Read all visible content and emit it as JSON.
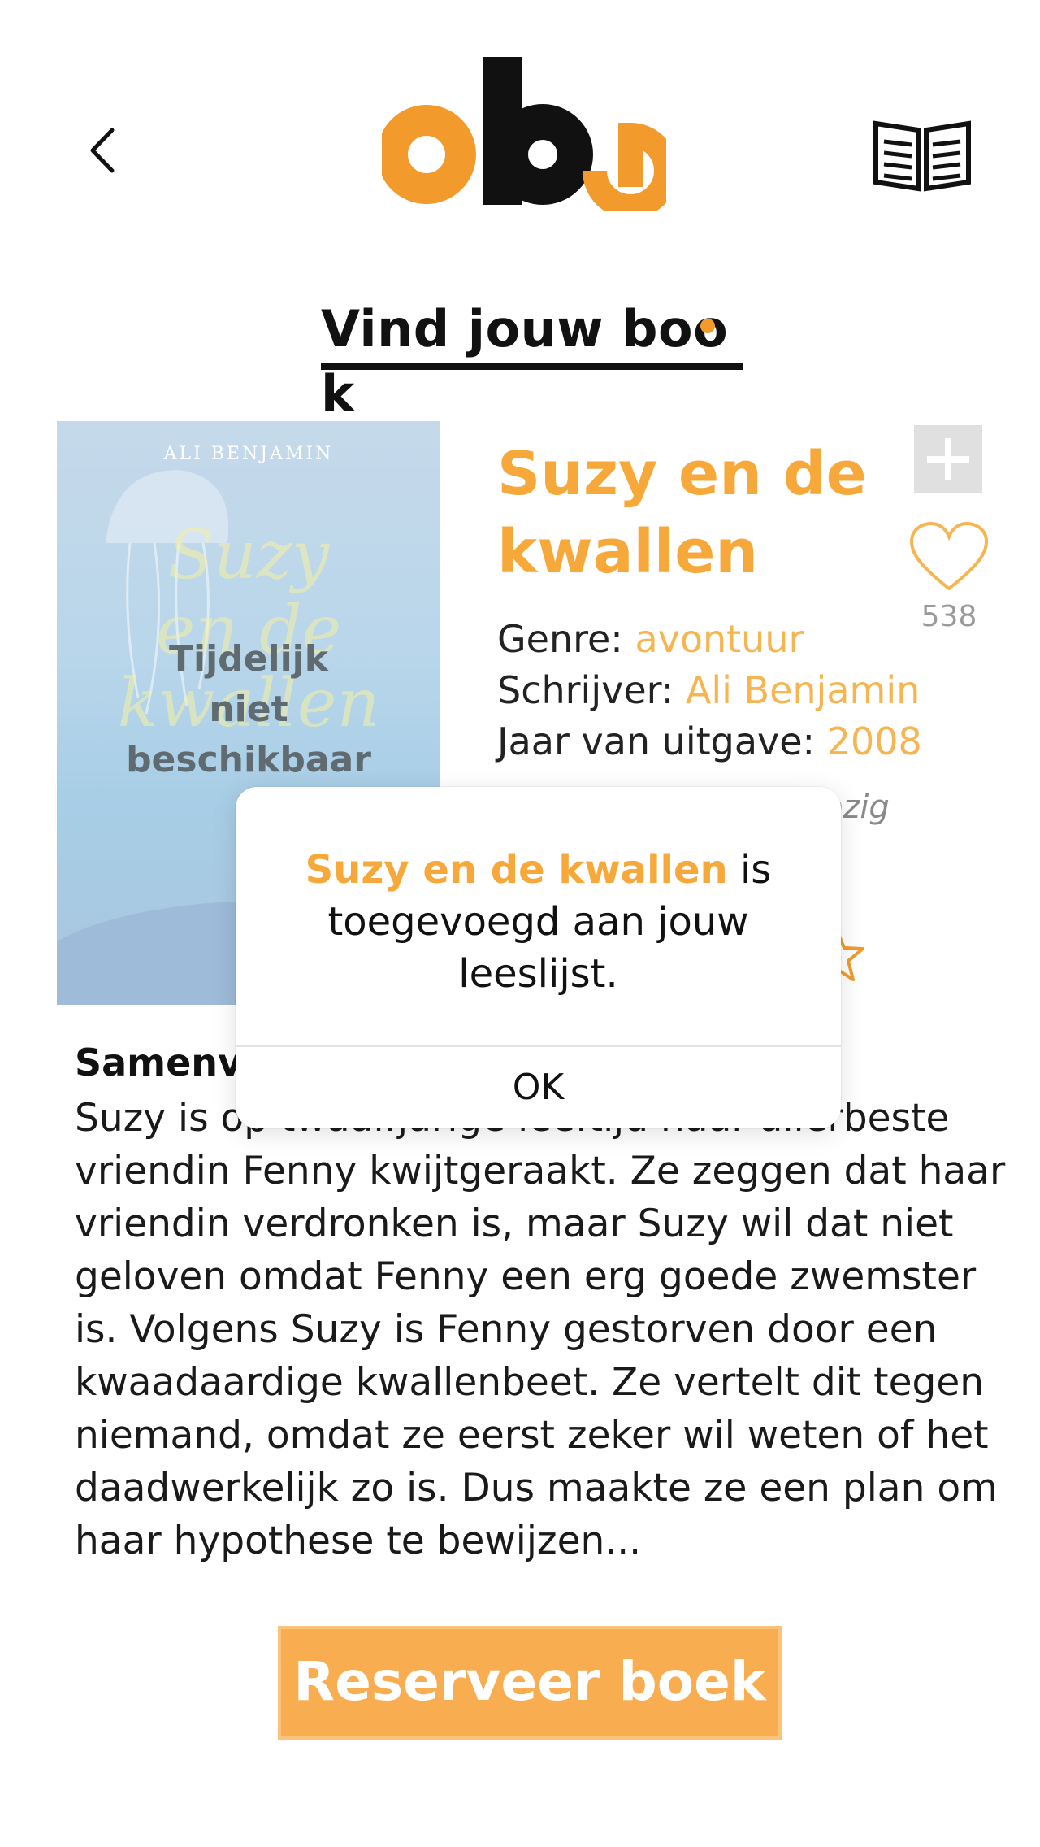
{
  "header": {
    "logo_text": "oba",
    "section_title_parts": [
      "Vind jouw bo",
      "o",
      "k"
    ]
  },
  "book": {
    "cover_author": "ALI BENJAMIN",
    "cover_script_title": [
      "Suzy",
      "en de",
      "kwallen"
    ],
    "availability_overlay": [
      "Tijdelijk",
      "niet",
      "beschikbaar"
    ],
    "title": "Suzy en de kwallen",
    "likes": "538",
    "meta": {
      "genre_label": "Genre: ",
      "genre_value": "avontuur",
      "writer_label": "Schrijver: ",
      "writer_value": "Ali Benjamin",
      "year_label": "Jaar van uitgave: ",
      "year_value": "2008"
    },
    "status_partial": "wezig"
  },
  "summary": {
    "title_partial": "Samenva",
    "text": "Suzy is op twaalfjarige leeftijd haar allerbeste vriendin Fenny kwijtgeraakt. Ze zeggen dat haar vriendin verdronken is, maar Suzy wil dat niet geloven omdat Fenny een erg goede zwemster is. Volgens Suzy is Fenny gestorven door een kwaadaardige kwallenbeet. Ze vertelt dit tegen niemand, omdat ze eerst zeker wil weten of het daadwerkelijk zo is. Dus maakte ze een plan om haar hypothese te bewijzen..."
  },
  "reserve_button": "Reserveer boek",
  "dialog": {
    "highlight": "Suzy en de kwallen",
    "message_rest": " is toegevoegd aan jouw leeslijst.",
    "ok": "OK"
  },
  "colors": {
    "accent": "#f6a93a",
    "accent_light": "#f6b551",
    "button": "#f8ad50"
  },
  "icons": {
    "back": "chevron-left-icon",
    "reader": "open-book-icon",
    "add": "plus-icon",
    "like": "heart-icon",
    "rating": "star-icon"
  }
}
